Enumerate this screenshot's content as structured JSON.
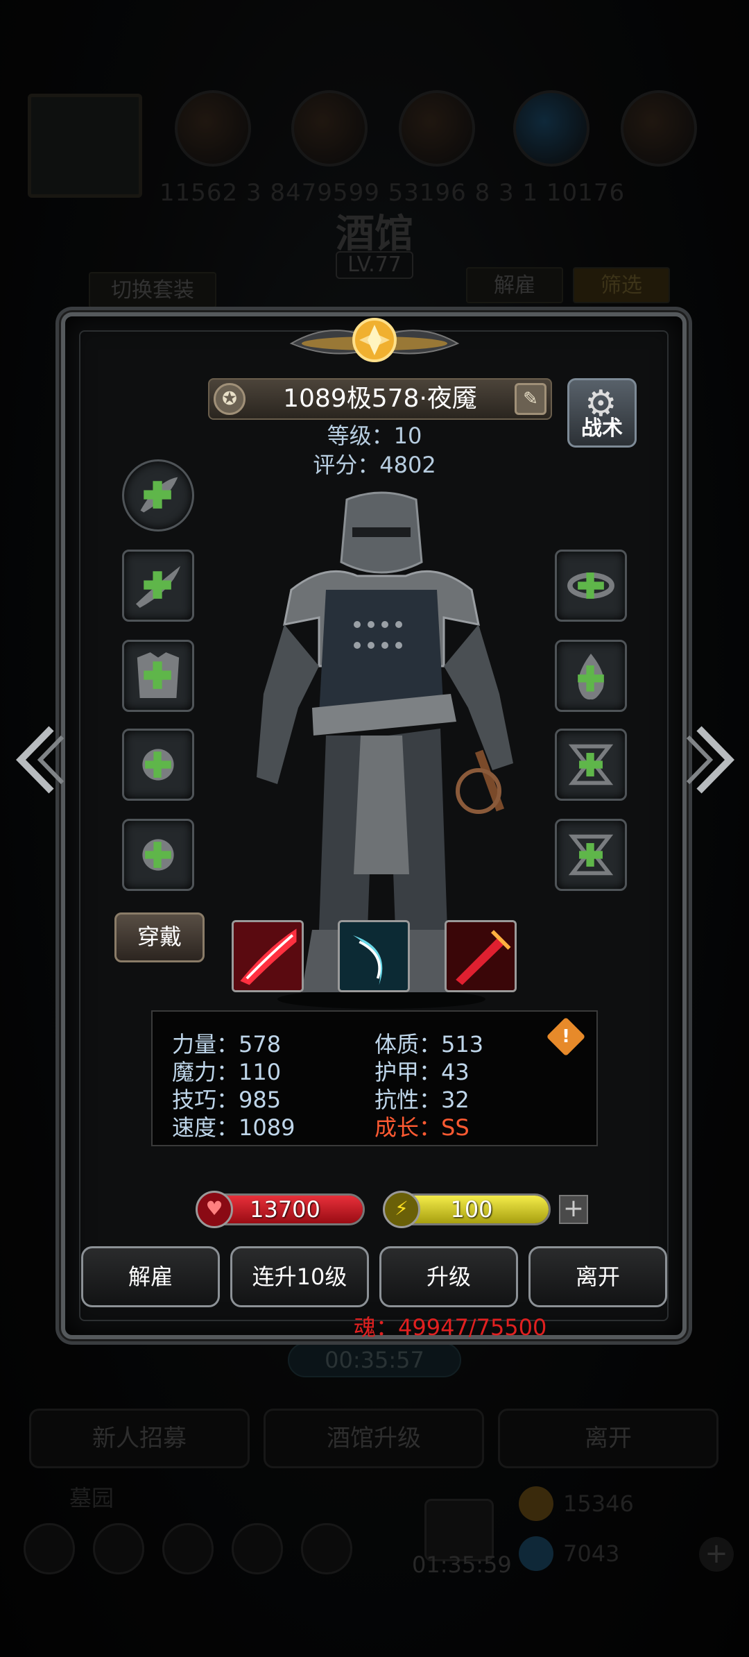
{
  "background": {
    "top_numbers": "11562 3 8479599 53196 8 3 1 10176",
    "tavern_title": "酒馆",
    "tavern_level": "LV.77",
    "switch_outfit": "切换套装",
    "dismiss": "解雇",
    "filter": "筛选",
    "timer": "00:35:57",
    "bottom_buttons": [
      "新人招募",
      "酒馆升级",
      "离开"
    ],
    "cemetery": "墓园",
    "gift_timer": "01:35:59",
    "gold": "15346",
    "gems": "7043"
  },
  "hero": {
    "name": "1089极578·夜魇",
    "level_label": "等级：10",
    "score_label": "评分：4802",
    "tactics_label": "战术",
    "wear_label": "穿戴"
  },
  "stats": {
    "strength": "力量：578",
    "magic": "魔力：110",
    "skill": "技巧：985",
    "speed": "速度：1089",
    "constitution": "体质：513",
    "armor": "护甲：43",
    "resistance": "抗性：32",
    "growth": "成长：SS",
    "warn_mark": "!"
  },
  "bars": {
    "hp": "13700",
    "energy": "100",
    "plus": "+"
  },
  "actions": {
    "dismiss": "解雇",
    "level_up_10": "连升10级",
    "level_up": "升级",
    "leave": "离开"
  },
  "soul": "魂：49947/75500",
  "icons": {
    "name_left": "medal-icon",
    "name_right": "edit-icon",
    "tactics": "gear-icon",
    "hp": "heart-icon",
    "energy": "lightning-icon"
  },
  "colors": {
    "hp_bar": "#c4121a",
    "energy_bar": "#e8e01a",
    "growth": "#ff5a32",
    "stat_text": "#bfd6ea",
    "soul": "#e02020"
  }
}
